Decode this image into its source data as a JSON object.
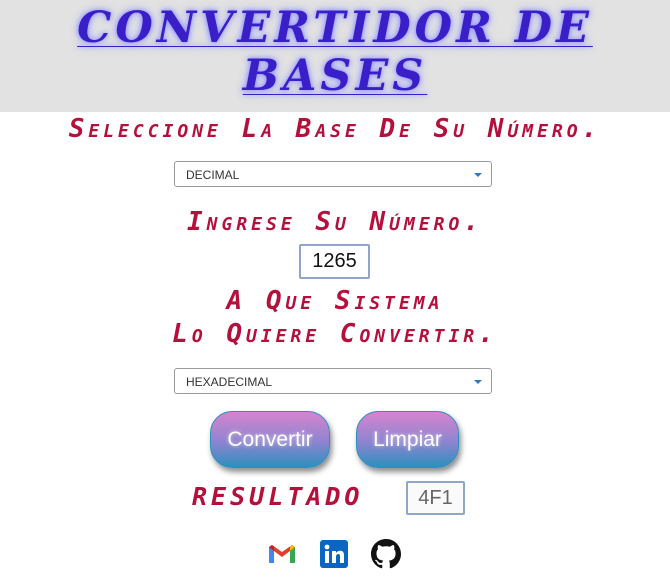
{
  "header": {
    "title_line1": "CONVERTIDOR DE",
    "title_line2": "BASES"
  },
  "labels": {
    "select_base": "Seleccione La Base De Su Número.",
    "enter_number": "Ingrese Su Número.",
    "target_line1": "A Que Sistema",
    "target_line2": "Lo Quiere Convertir.",
    "result": "RESULTADO"
  },
  "inputs": {
    "source_base": "DECIMAL",
    "number": "1265",
    "target_base": "HEXADECIMAL",
    "result_value": "4F1"
  },
  "buttons": {
    "convert": "Convertir",
    "clear": "Limpiar"
  },
  "social": [
    "gmail-icon",
    "linkedin-icon",
    "github-icon"
  ],
  "colors": {
    "title": "#3a1ec8",
    "labels": "#b5103c",
    "header_bg": "#e2e2e2"
  }
}
